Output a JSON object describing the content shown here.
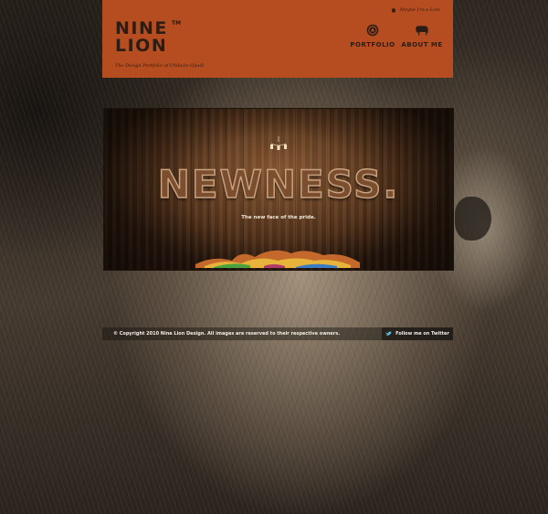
{
  "header": {
    "logo_line1": "NINE",
    "logo_line2": "LION",
    "logo_tm": "TM",
    "tagline": "The Design Portfolio of Chibuzo Ojiadi",
    "twitter_link": "Maybe I'm a Lion",
    "nav": [
      {
        "label": "PORTFOLIO",
        "icon": "portfolio-badge-icon"
      },
      {
        "label": "ABOUT ME",
        "icon": "lion-icon"
      }
    ]
  },
  "banner": {
    "headline": "NEWNESS.",
    "subhead": "The new face of the pride."
  },
  "footer": {
    "copyright": "© Copyright 2010 Nine Lion Design. All images are reserved to their respective owners.",
    "follow": "Follow me on Twitter",
    "follow_icon": "twitter-bird-icon"
  },
  "colors": {
    "header_bg": "#b64d20",
    "header_text": "#2b1d14",
    "banner_wood": "#6a4020"
  }
}
